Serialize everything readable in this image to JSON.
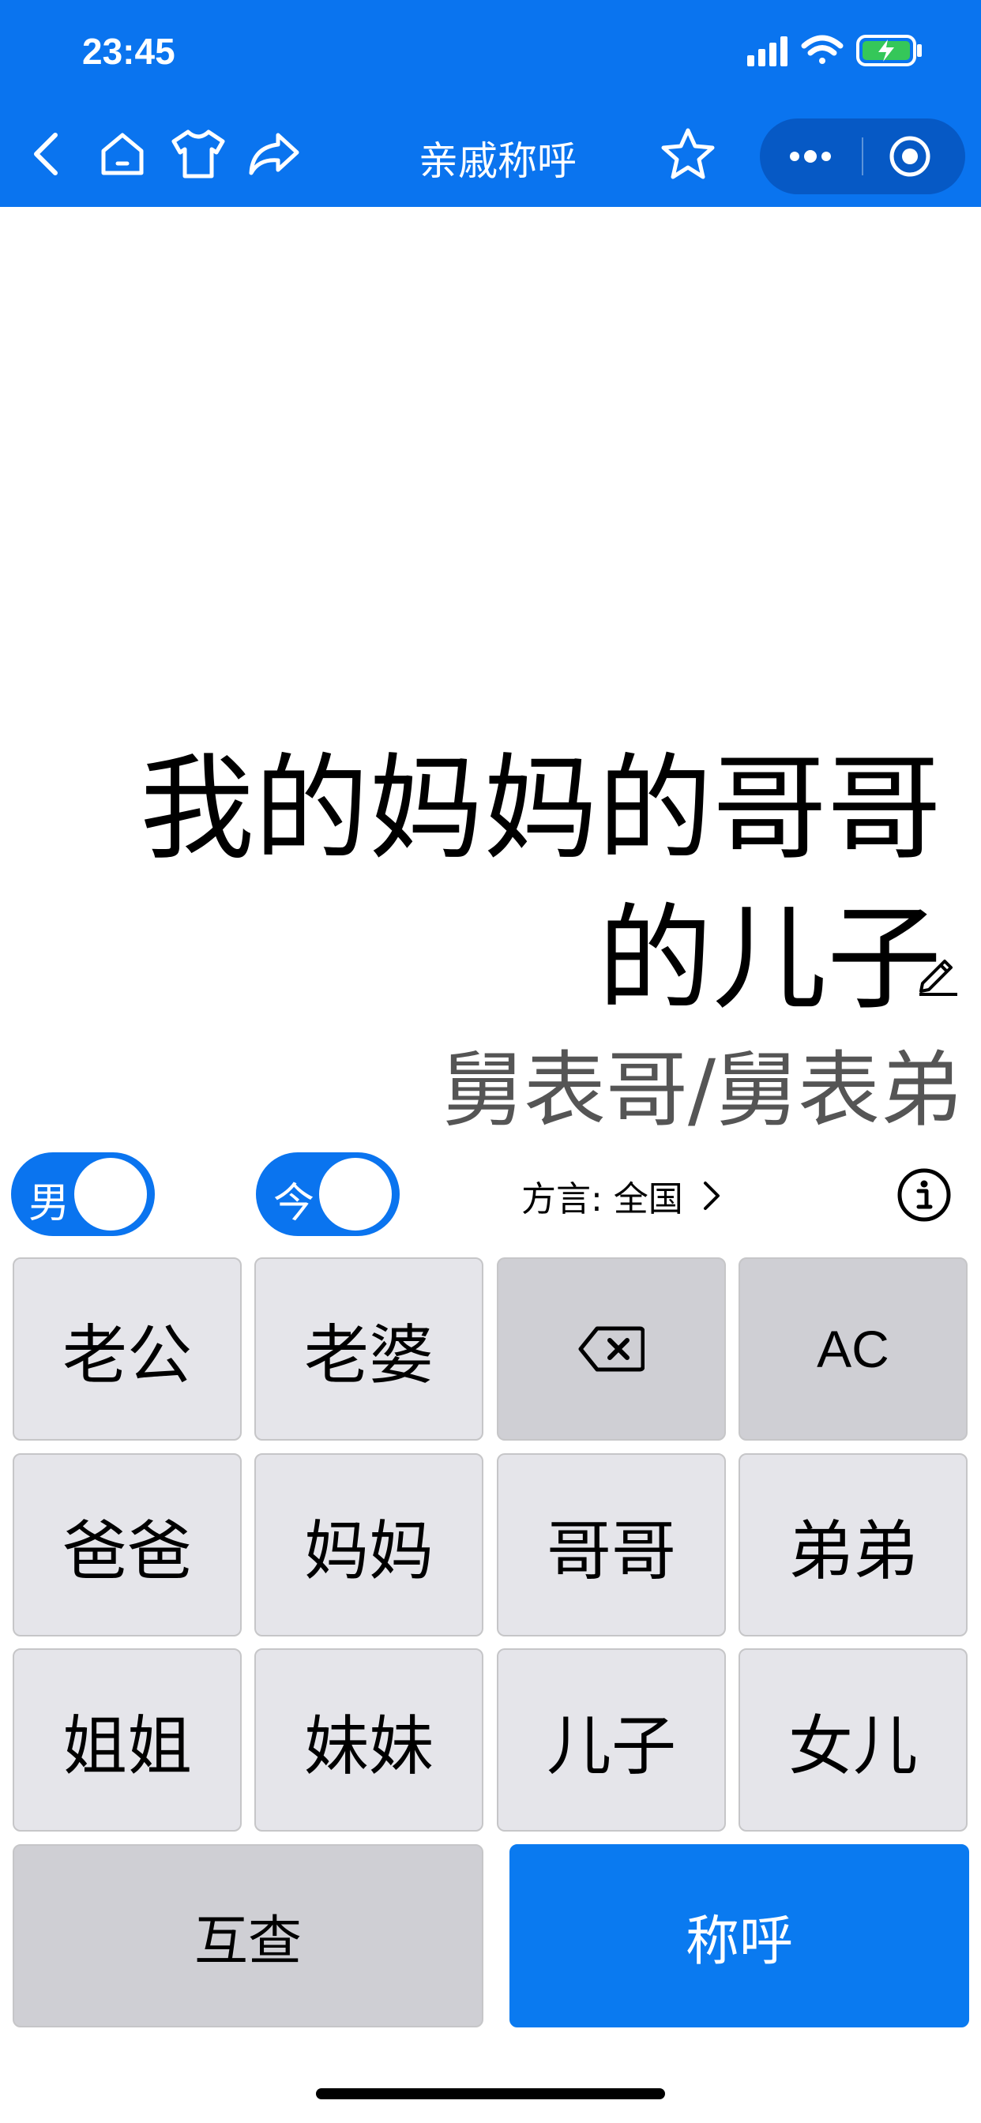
{
  "status_bar": {
    "time": "23:45"
  },
  "nav": {
    "title": "亲戚称呼"
  },
  "display": {
    "expression": "我的妈妈的哥哥的儿子",
    "result": "舅表哥/舅表弟"
  },
  "controls": {
    "gender_toggle_label": "男",
    "time_toggle_label": "今",
    "dialect_label": "方言: 全国"
  },
  "keypad": {
    "keys": [
      "老公",
      "老婆",
      "",
      "AC",
      "爸爸",
      "妈妈",
      "哥哥",
      "弟弟",
      "姐姐",
      "妹妹",
      "儿子",
      "女儿"
    ],
    "mutual_label": "互查",
    "submit_label": "称呼"
  },
  "colors": {
    "brand_blue": "#0a74ef",
    "key_bg": "#e5e5ea",
    "key_dark_bg": "#cfcfd4"
  }
}
